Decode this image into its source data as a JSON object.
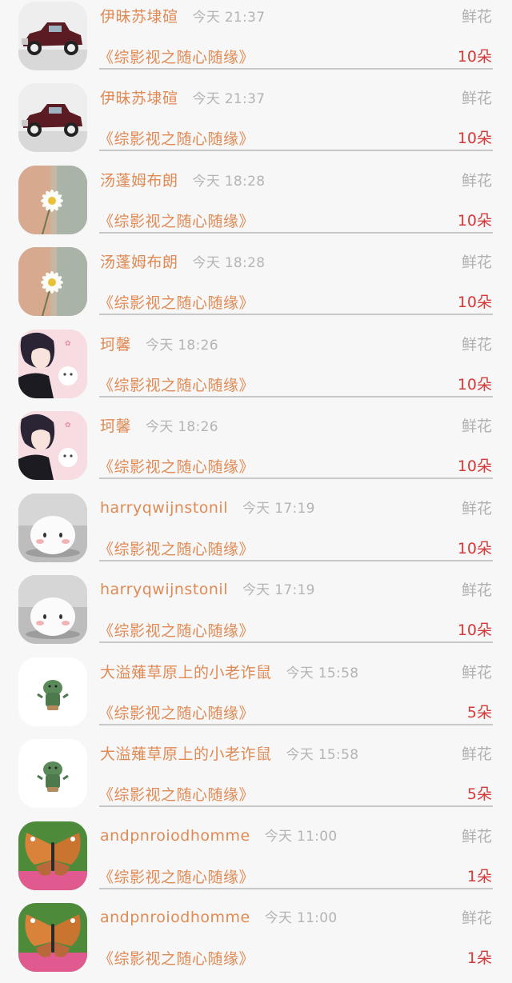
{
  "records": [
    {
      "avatar": "vintage-car",
      "name": "伊昧苏埭碹",
      "time": "今天 21:37",
      "gift": "鲜花",
      "work": "《综影视之随心随缘》",
      "count": "10朵"
    },
    {
      "avatar": "vintage-car",
      "name": "伊昧苏埭碹",
      "time": "今天 21:37",
      "gift": "鲜花",
      "work": "《综影视之随心随缘》",
      "count": "10朵"
    },
    {
      "avatar": "daisy",
      "name": "汤蓬姆布朗",
      "time": "今天 18:28",
      "gift": "鲜花",
      "work": "《综影视之随心随缘》",
      "count": "10朵"
    },
    {
      "avatar": "daisy",
      "name": "汤蓬姆布朗",
      "time": "今天 18:28",
      "gift": "鲜花",
      "work": "《综影视之随心随缘》",
      "count": "10朵"
    },
    {
      "avatar": "anime-boy",
      "name": "珂馨",
      "time": "今天 18:26",
      "gift": "鲜花",
      "work": "《综影视之随心随缘》",
      "count": "10朵"
    },
    {
      "avatar": "anime-boy",
      "name": "珂馨",
      "time": "今天 18:26",
      "gift": "鲜花",
      "work": "《综影视之随心随缘》",
      "count": "10朵"
    },
    {
      "avatar": "mochi",
      "name": "harryqwijnstonil",
      "time": "今天 17:19",
      "gift": "鲜花",
      "work": "《综影视之随心随缘》",
      "count": "10朵"
    },
    {
      "avatar": "mochi",
      "name": "harryqwijnstonil",
      "time": "今天 17:19",
      "gift": "鲜花",
      "work": "《综影视之随心随缘》",
      "count": "10朵"
    },
    {
      "avatar": "cactus",
      "name": "大溢薙草原上的小老诈鼠",
      "time": "今天 15:58",
      "gift": "鲜花",
      "work": "《综影视之随心随缘》",
      "count": "5朵"
    },
    {
      "avatar": "cactus",
      "name": "大溢薙草原上的小老诈鼠",
      "time": "今天 15:58",
      "gift": "鲜花",
      "work": "《综影视之随心随缘》",
      "count": "5朵"
    },
    {
      "avatar": "butterfly",
      "name": "andpnroiodhomme",
      "time": "今天 11:00",
      "gift": "鲜花",
      "work": "《综影视之随心随缘》",
      "count": "1朵"
    },
    {
      "avatar": "butterfly",
      "name": "andpnroiodhomme",
      "time": "今天 11:00",
      "gift": "鲜花",
      "work": "《综影视之随心随缘》",
      "count": "1朵"
    }
  ]
}
